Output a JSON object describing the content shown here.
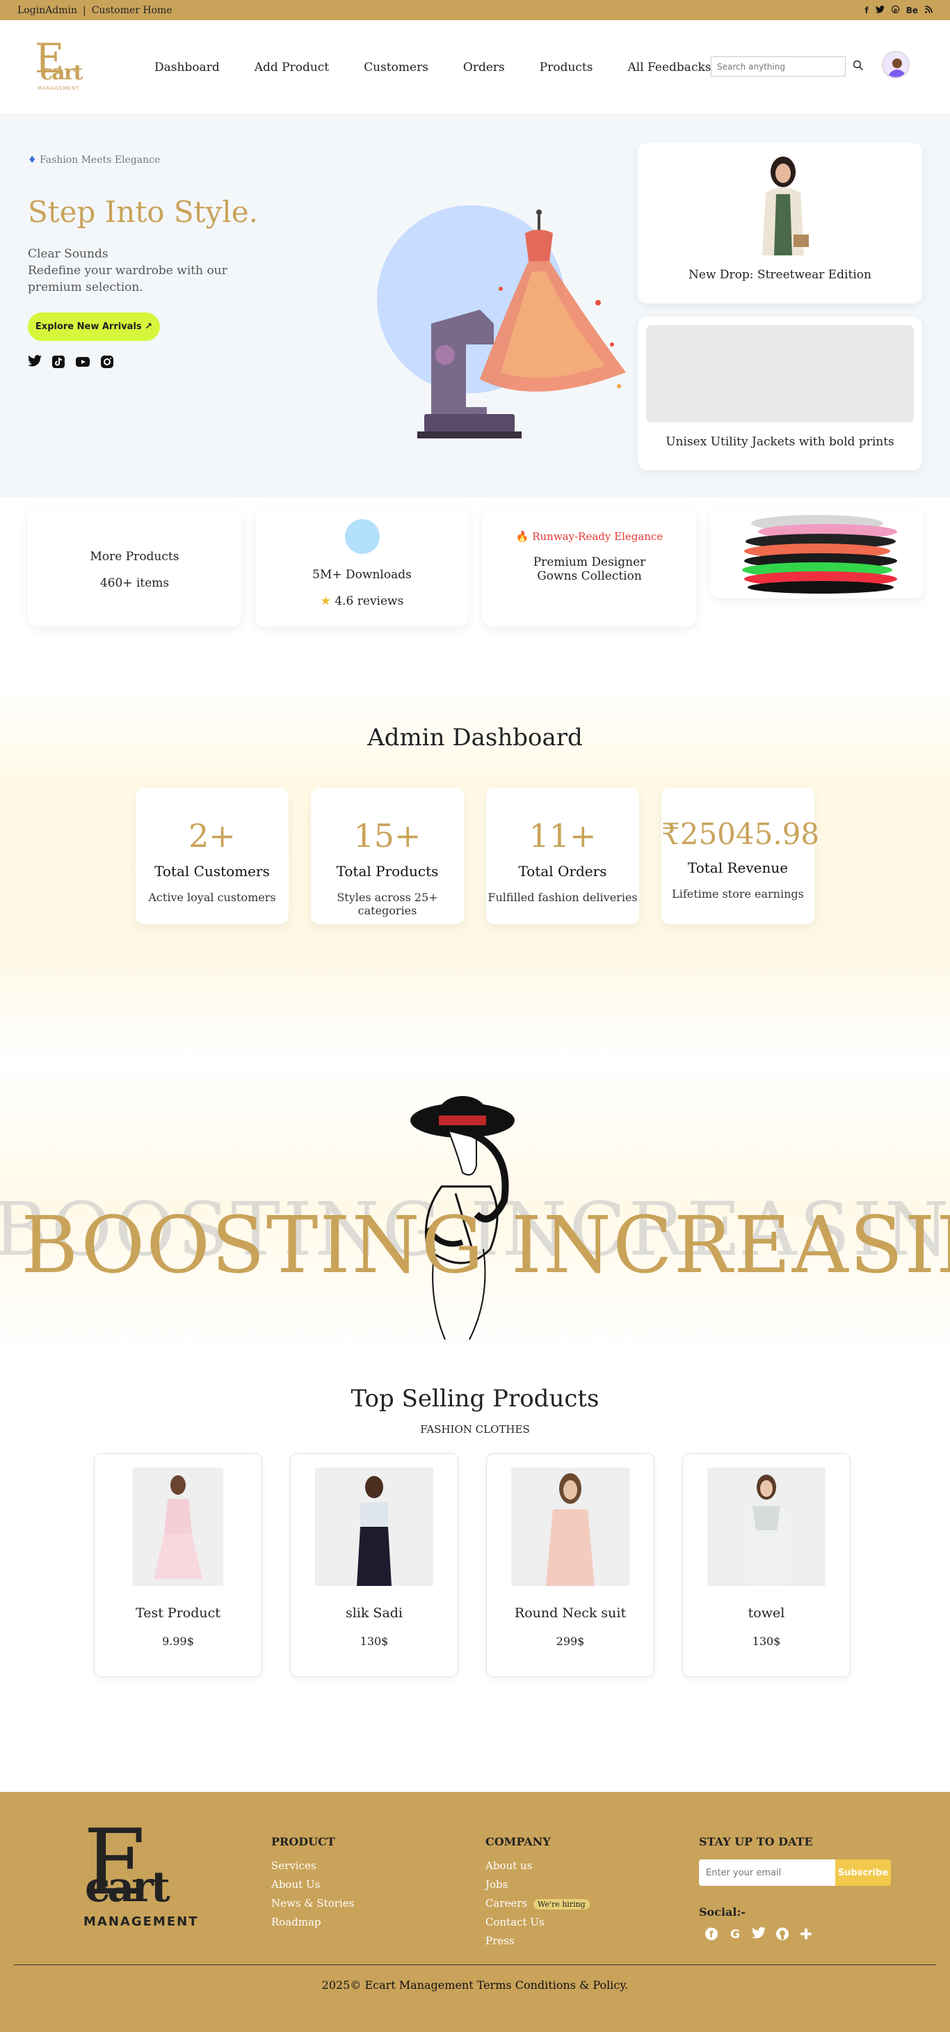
{
  "topbar": {
    "login": "LoginAdmin",
    "separator": "|",
    "customer_home": "Customer Home",
    "social_icons": [
      "facebook-icon",
      "twitter-icon",
      "pinterest-icon",
      "behance-icon",
      "rss-icon"
    ],
    "behance_label": "Be"
  },
  "brand": {
    "logo_e": "E",
    "logo_cart": "cart",
    "logo_sub": "MANAGEMENT",
    "color": "#c9a35a"
  },
  "nav": {
    "items": [
      "Dashboard",
      "Add Product",
      "Customers",
      "Orders",
      "Products",
      "All Feedbacks"
    ],
    "search_placeholder": "Search anything"
  },
  "hero": {
    "tag": "Fashion Meets Elegance",
    "title": "Step Into Style.",
    "sub1": "Clear Sounds",
    "sub2": "Redefine your wardrobe with our premium selection.",
    "cta": "Explore New Arrivals ↗",
    "socials": [
      "twitter-icon",
      "tiktok-icon",
      "youtube-icon",
      "instagram-icon"
    ],
    "card1_title": "New Drop: Streetwear Edition",
    "card2_title": "Unisex Utility Jackets with bold prints"
  },
  "stats": {
    "more_products": "More Products",
    "items": "460+ items",
    "downloads": "5M+ Downloads",
    "reviews": "4.6 reviews",
    "runway": "Runway-Ready Elegance",
    "gowns": "Premium Designer Gowns Collection"
  },
  "dashboard": {
    "title": "Admin Dashboard",
    "kpis": [
      {
        "num": "2+",
        "label": "Total Customers",
        "desc": "Active loyal customers"
      },
      {
        "num": "15+",
        "label": "Total Products",
        "desc": "Styles across 25+ categories"
      },
      {
        "num": "11+",
        "label": "Total Orders",
        "desc": "Fulfilled fashion deliveries"
      },
      {
        "num": "₹25045.98",
        "label": "Total Revenue",
        "desc": "Lifetime store earnings"
      }
    ]
  },
  "marquee": {
    "ghost": "BOOSTING INCREASING",
    "gold": "BOOSTING INCREASING"
  },
  "top_selling": {
    "title": "Top Selling Products",
    "kicker": "FASHION CLOTHES",
    "products": [
      {
        "name": "Test Product",
        "price": "9.99$"
      },
      {
        "name": "slik Sadi",
        "price": "130$"
      },
      {
        "name": "Round Neck suit",
        "price": "299$"
      },
      {
        "name": "towel",
        "price": "130$"
      }
    ]
  },
  "footer": {
    "logo_e": "E",
    "logo_cart": "cart",
    "logo_sub": "MANAGEMENT",
    "product_title": "PRODUCT",
    "product_links": [
      "Services",
      "About Us",
      "News & Stories",
      "Roadmap"
    ],
    "company_title": "COMPANY",
    "company_links": [
      "About us",
      "Jobs",
      "Careers",
      "Contact Us",
      "Press"
    ],
    "hiring_badge": "We're hiring",
    "newsletter_title": "STAY UP TO DATE",
    "email_placeholder": "Enter your email",
    "subscribe": "Subscribe",
    "social_label": "Social:-",
    "social_icons": [
      "facebook-icon",
      "google-icon",
      "twitter-icon",
      "github-icon",
      "slack-icon"
    ],
    "copyright": "2025© Ecart Management Terms Conditions & Policy."
  }
}
